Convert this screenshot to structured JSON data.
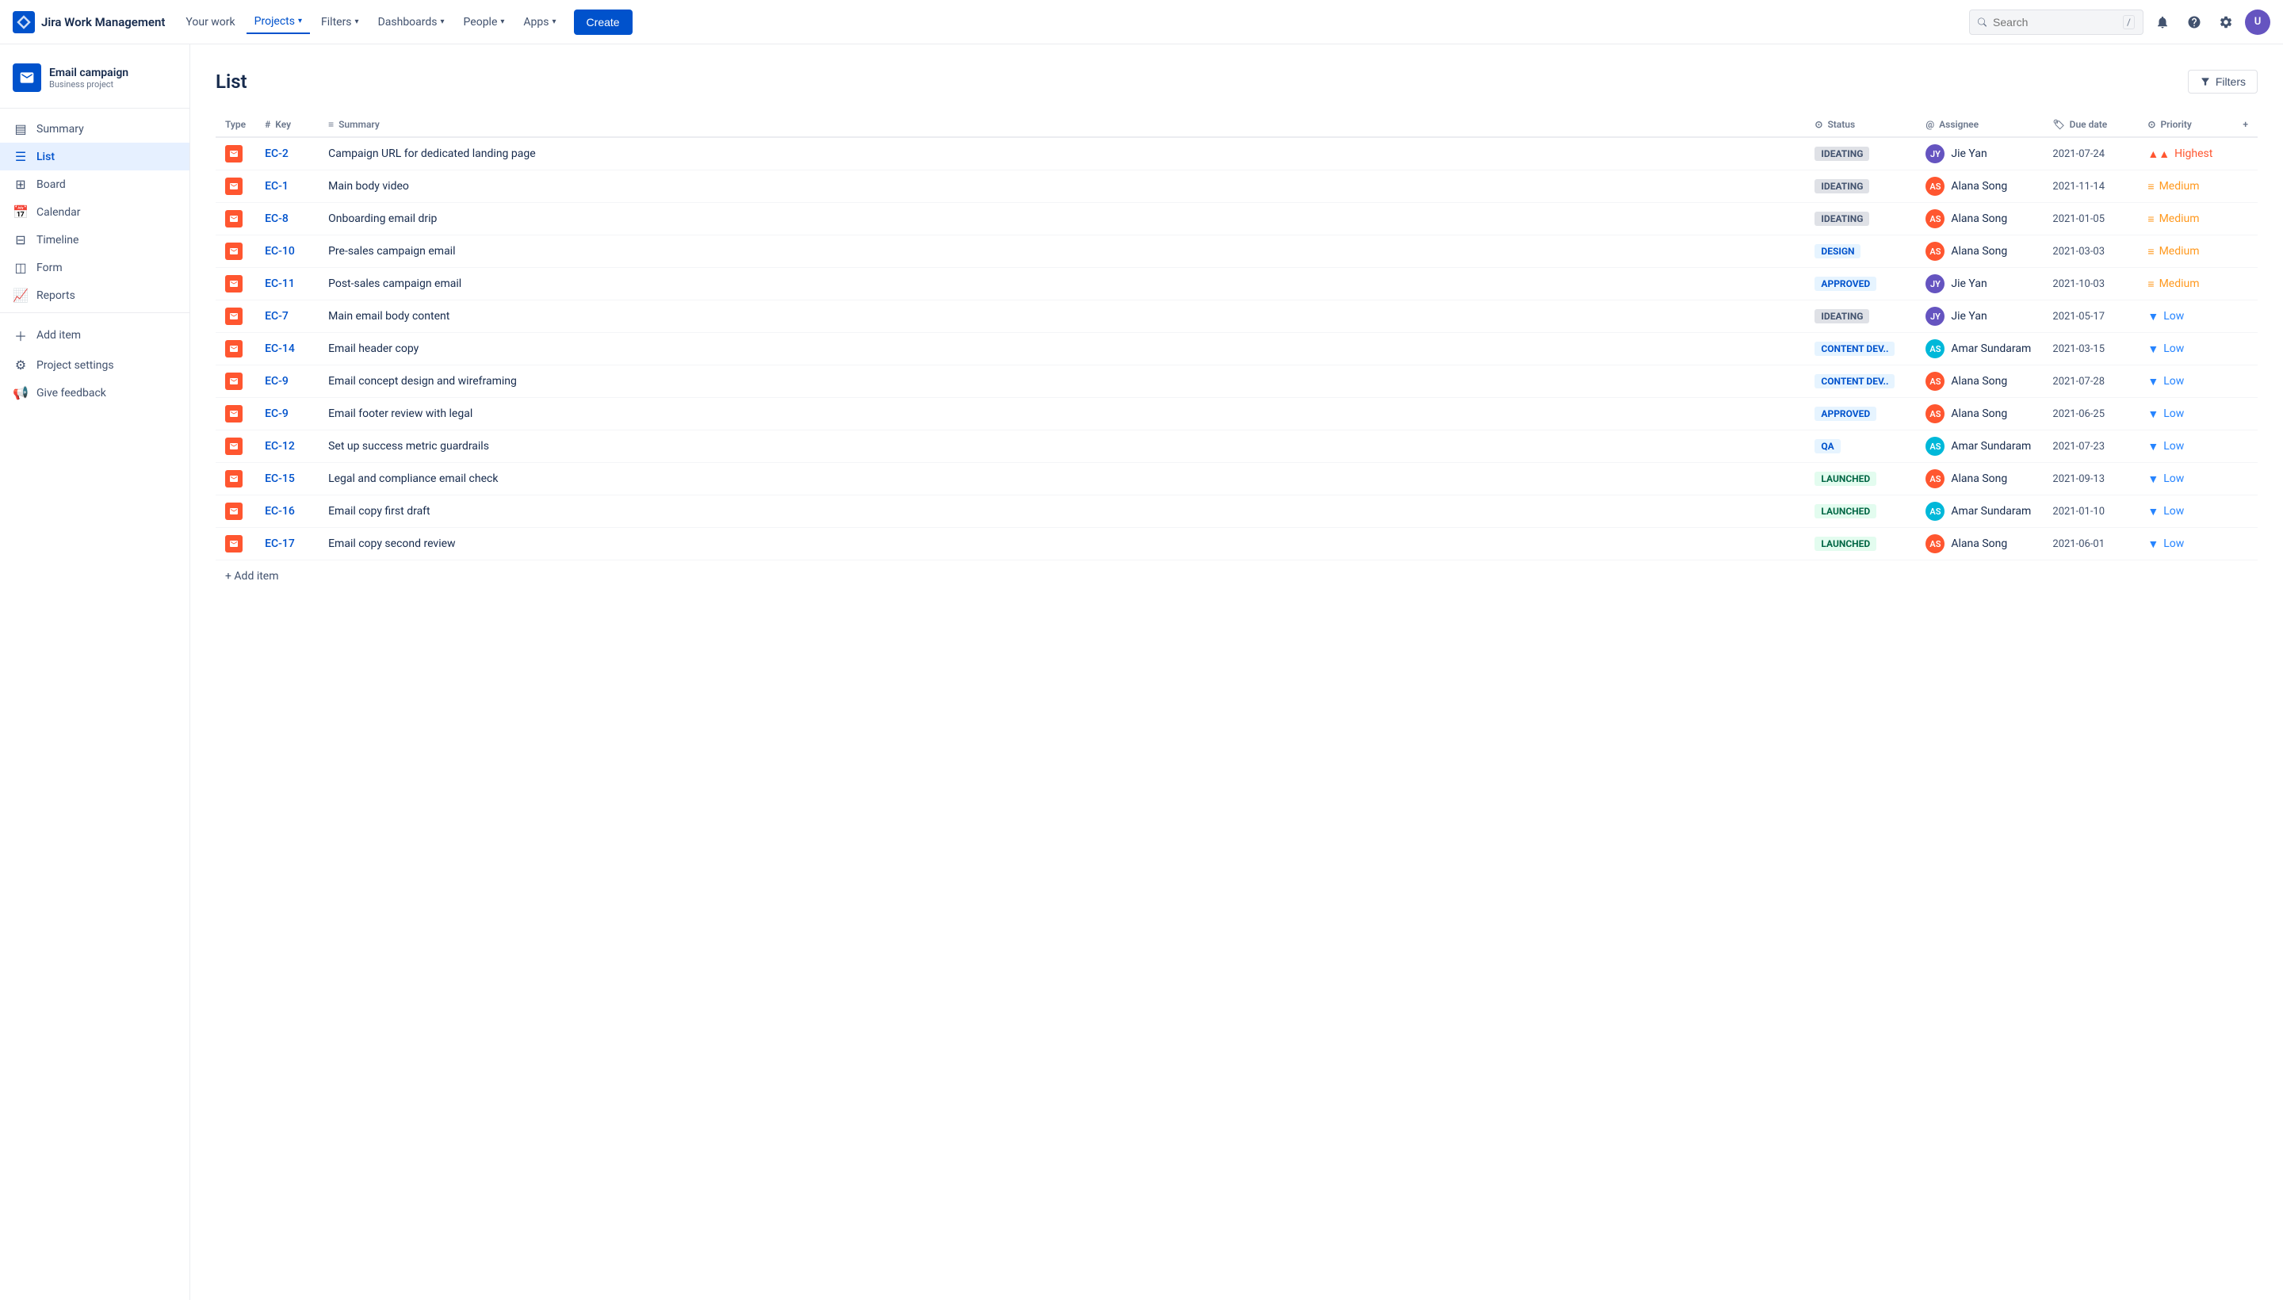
{
  "app": {
    "name": "Jira Work Management"
  },
  "nav": {
    "items": [
      {
        "label": "Your work",
        "active": false
      },
      {
        "label": "Projects",
        "active": true
      },
      {
        "label": "Filters",
        "active": false
      },
      {
        "label": "Dashboards",
        "active": false
      },
      {
        "label": "People",
        "active": false
      },
      {
        "label": "Apps",
        "active": false
      }
    ],
    "create_label": "Create",
    "search_placeholder": "Search",
    "search_key": "/"
  },
  "sidebar": {
    "project_name": "Email campaign",
    "project_type": "Business project",
    "items": [
      {
        "id": "summary",
        "label": "Summary",
        "icon": "▤",
        "active": false
      },
      {
        "id": "list",
        "label": "List",
        "icon": "☰",
        "active": true
      },
      {
        "id": "board",
        "label": "Board",
        "icon": "⊞",
        "active": false
      },
      {
        "id": "calendar",
        "label": "Calendar",
        "icon": "📅",
        "active": false
      },
      {
        "id": "timeline",
        "label": "Timeline",
        "icon": "⊟",
        "active": false
      },
      {
        "id": "form",
        "label": "Form",
        "icon": "◫",
        "active": false
      },
      {
        "id": "reports",
        "label": "Reports",
        "icon": "📈",
        "active": false
      },
      {
        "id": "add-item",
        "label": "Add item",
        "icon": "＋",
        "active": false
      },
      {
        "id": "project-settings",
        "label": "Project settings",
        "icon": "⚙",
        "active": false
      },
      {
        "id": "give-feedback",
        "label": "Give feedback",
        "icon": "📢",
        "active": false
      }
    ]
  },
  "main": {
    "title": "List",
    "filter_label": "Filters",
    "table": {
      "columns": [
        {
          "id": "type",
          "label": "Type"
        },
        {
          "id": "key",
          "label": "Key"
        },
        {
          "id": "summary",
          "label": "Summary"
        },
        {
          "id": "status",
          "label": "Status"
        },
        {
          "id": "assignee",
          "label": "Assignee"
        },
        {
          "id": "due_date",
          "label": "Due date"
        },
        {
          "id": "priority",
          "label": "Priority"
        }
      ],
      "rows": [
        {
          "key": "EC-2",
          "summary": "Campaign URL for dedicated landing page",
          "status": "IDEATING",
          "status_class": "status-ideating",
          "assignee": "Jie Yan",
          "assignee_color": "#6554c0",
          "due_date": "2021-07-24",
          "priority": "Highest",
          "priority_class": "priority-highest",
          "priority_icon": "▲▲"
        },
        {
          "key": "EC-1",
          "summary": "Main body video",
          "status": "IDEATING",
          "status_class": "status-ideating",
          "assignee": "Alana Song",
          "assignee_color": "#ff5630",
          "due_date": "2021-11-14",
          "priority": "Medium",
          "priority_class": "priority-medium",
          "priority_icon": "≡"
        },
        {
          "key": "EC-8",
          "summary": "Onboarding email drip",
          "status": "IDEATING",
          "status_class": "status-ideating",
          "assignee": "Alana Song",
          "assignee_color": "#ff5630",
          "due_date": "2021-01-05",
          "priority": "Medium",
          "priority_class": "priority-medium",
          "priority_icon": "≡"
        },
        {
          "key": "EC-10",
          "summary": "Pre-sales campaign email",
          "status": "DESIGN",
          "status_class": "status-design",
          "assignee": "Alana Song",
          "assignee_color": "#ff5630",
          "due_date": "2021-03-03",
          "priority": "Medium",
          "priority_class": "priority-medium",
          "priority_icon": "≡"
        },
        {
          "key": "EC-11",
          "summary": "Post-sales campaign email",
          "status": "APPROVED",
          "status_class": "status-approved",
          "assignee": "Jie Yan",
          "assignee_color": "#6554c0",
          "due_date": "2021-10-03",
          "priority": "Medium",
          "priority_class": "priority-medium",
          "priority_icon": "≡"
        },
        {
          "key": "EC-7",
          "summary": "Main email body content",
          "status": "IDEATING",
          "status_class": "status-ideating",
          "assignee": "Jie Yan",
          "assignee_color": "#6554c0",
          "due_date": "2021-05-17",
          "priority": "Low",
          "priority_class": "priority-low",
          "priority_icon": "▼"
        },
        {
          "key": "EC-14",
          "summary": "Email header copy",
          "status": "CONTENT DEV..",
          "status_class": "status-content-dev",
          "assignee": "Amar Sundaram",
          "assignee_color": "#00b8d9",
          "due_date": "2021-03-15",
          "priority": "Low",
          "priority_class": "priority-low",
          "priority_icon": "▼"
        },
        {
          "key": "EC-9",
          "summary": "Email concept design and wireframing",
          "status": "CONTENT DEV..",
          "status_class": "status-content-dev",
          "assignee": "Alana Song",
          "assignee_color": "#ff5630",
          "due_date": "2021-07-28",
          "priority": "Low",
          "priority_class": "priority-low",
          "priority_icon": "▼"
        },
        {
          "key": "EC-9",
          "summary": "Email footer review with legal",
          "status": "APPROVED",
          "status_class": "status-approved",
          "assignee": "Alana Song",
          "assignee_color": "#ff5630",
          "due_date": "2021-06-25",
          "priority": "Low",
          "priority_class": "priority-low",
          "priority_icon": "▼"
        },
        {
          "key": "EC-12",
          "summary": "Set up success metric guardrails",
          "status": "QA",
          "status_class": "status-qa",
          "assignee": "Amar Sundaram",
          "assignee_color": "#00b8d9",
          "due_date": "2021-07-23",
          "priority": "Low",
          "priority_class": "priority-low",
          "priority_icon": "▼"
        },
        {
          "key": "EC-15",
          "summary": "Legal and compliance email check",
          "status": "LAUNCHED",
          "status_class": "status-launched",
          "assignee": "Alana Song",
          "assignee_color": "#ff5630",
          "due_date": "2021-09-13",
          "priority": "Low",
          "priority_class": "priority-low",
          "priority_icon": "▼"
        },
        {
          "key": "EC-16",
          "summary": "Email copy first draft",
          "status": "LAUNCHED",
          "status_class": "status-launched",
          "assignee": "Amar Sundaram",
          "assignee_color": "#00b8d9",
          "due_date": "2021-01-10",
          "priority": "Low",
          "priority_class": "priority-low",
          "priority_icon": "▼"
        },
        {
          "key": "EC-17",
          "summary": "Email copy second review",
          "status": "LAUNCHED",
          "status_class": "status-launched",
          "assignee": "Alana Song",
          "assignee_color": "#ff5630",
          "due_date": "2021-06-01",
          "priority": "Low",
          "priority_class": "priority-low",
          "priority_icon": "▼"
        }
      ],
      "add_item_label": "+ Add item"
    }
  }
}
